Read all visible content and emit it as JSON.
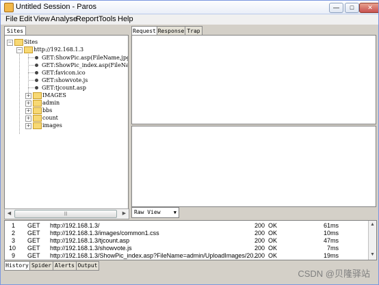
{
  "window": {
    "title": "Untitled Session - Paros",
    "minimize_glyph": "—",
    "maximize_glyph": "□",
    "close_glyph": "✕"
  },
  "menu": [
    "File",
    "Edit",
    "View",
    "Analyse",
    "Report",
    "Tools",
    "Help"
  ],
  "left_tab": "Sites",
  "tree": {
    "root": "Sites",
    "host": "http://192.168.1.3",
    "requests": [
      "GET:ShowPic.asp(FileName,jpgsize)",
      "GET:ShowPic_index.asp(FileName)",
      "GET:favicon.ico",
      "GET:showvote.js",
      "GET:tjcount.asp"
    ],
    "folders": [
      "IMAGES",
      "admin",
      "bbs",
      "count",
      "images"
    ]
  },
  "right_tabs": [
    "Request",
    "Response",
    "Trap"
  ],
  "view_select": "Raw View",
  "history": {
    "rows": [
      {
        "id": "1",
        "method": "GET",
        "url": "http://192.168.1.3/",
        "code": "200",
        "reason": "OK",
        "time": "61ms"
      },
      {
        "id": "2",
        "method": "GET",
        "url": "http://192.168.1.3/images/common1.css",
        "code": "200",
        "reason": "OK",
        "time": "10ms"
      },
      {
        "id": "3",
        "method": "GET",
        "url": "http://192.168.1.3/tjcount.asp",
        "code": "200",
        "reason": "OK",
        "time": "47ms"
      },
      {
        "id": "10",
        "method": "GET",
        "url": "http://192.168.1.3/showvote.js",
        "code": "200",
        "reason": "OK",
        "time": "7ms"
      },
      {
        "id": "9",
        "method": "GET",
        "url": "http://192.168.1.3/ShowPic_index.asp?FileName=admin/UploadImages/20...",
        "code": "200",
        "reason": "OK",
        "time": "19ms"
      }
    ]
  },
  "bottom_tabs": [
    "History",
    "Spider",
    "Alerts",
    "Output"
  ],
  "watermark": "CSDN @贝隆驿站"
}
